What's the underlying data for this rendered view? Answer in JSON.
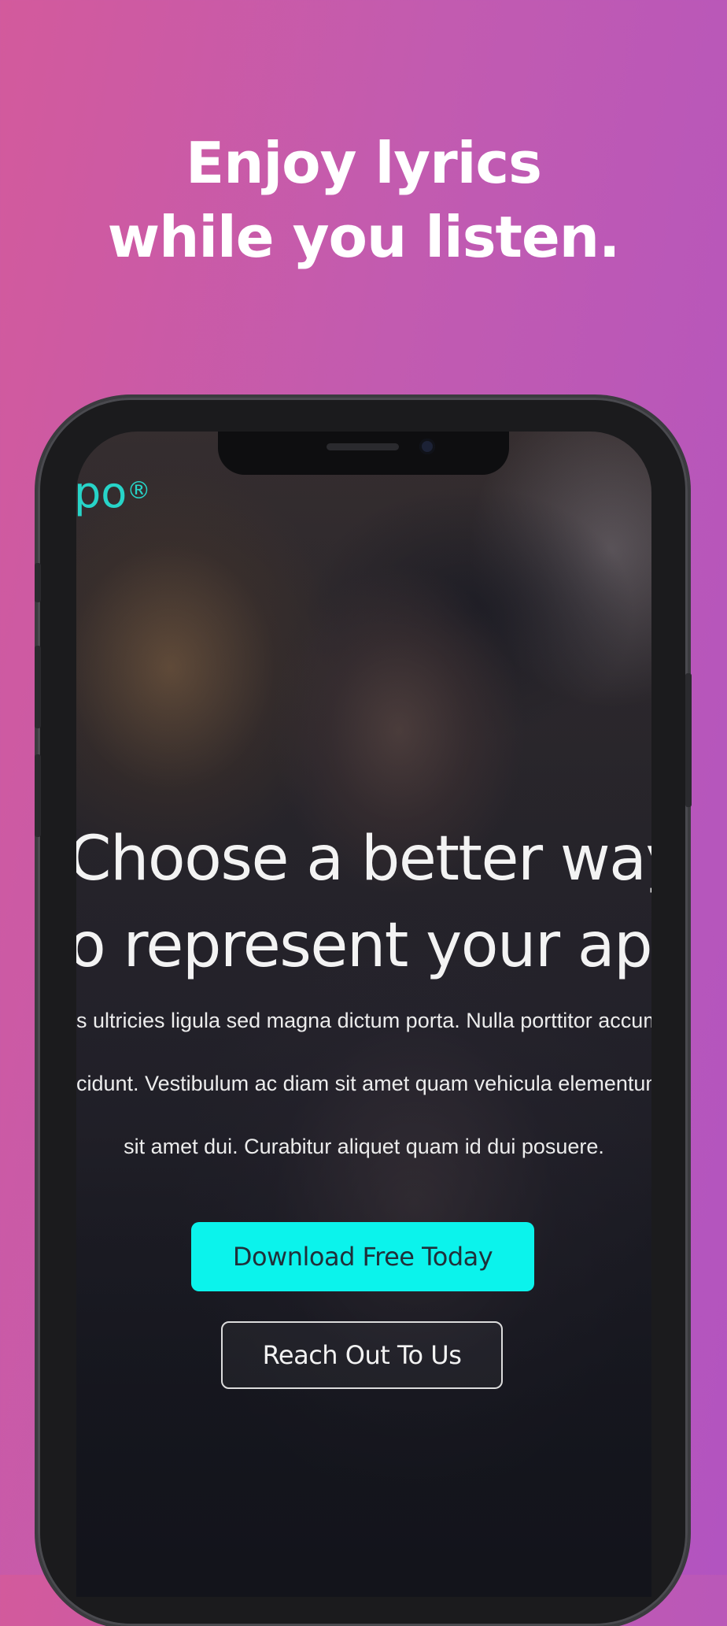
{
  "promo": {
    "headline_line1": "Enjoy lyrics",
    "headline_line2": "while you listen."
  },
  "app": {
    "brand": "po",
    "brand_mark": "®",
    "hero": {
      "title_line1": "Choose a better way",
      "title_line2": "o represent your app",
      "body_line1": "s ultricies ligula sed magna dictum porta. Nulla porttitor accums",
      "body_line2": "cidunt. Vestibulum ac diam sit amet quam vehicula elementum s",
      "body_line3": "sit amet dui. Curabitur aliquet quam id dui posuere."
    },
    "buttons": {
      "primary": "Download Free Today",
      "secondary": "Reach Out To Us"
    }
  },
  "colors": {
    "accent": "#0bf3ec",
    "brand_text": "#27d4c8",
    "background_start": "#d35a9c",
    "background_end": "#b254c0"
  },
  "icons": {
    "front_camera": "camera-icon",
    "speaker": "speaker-grille-icon"
  }
}
